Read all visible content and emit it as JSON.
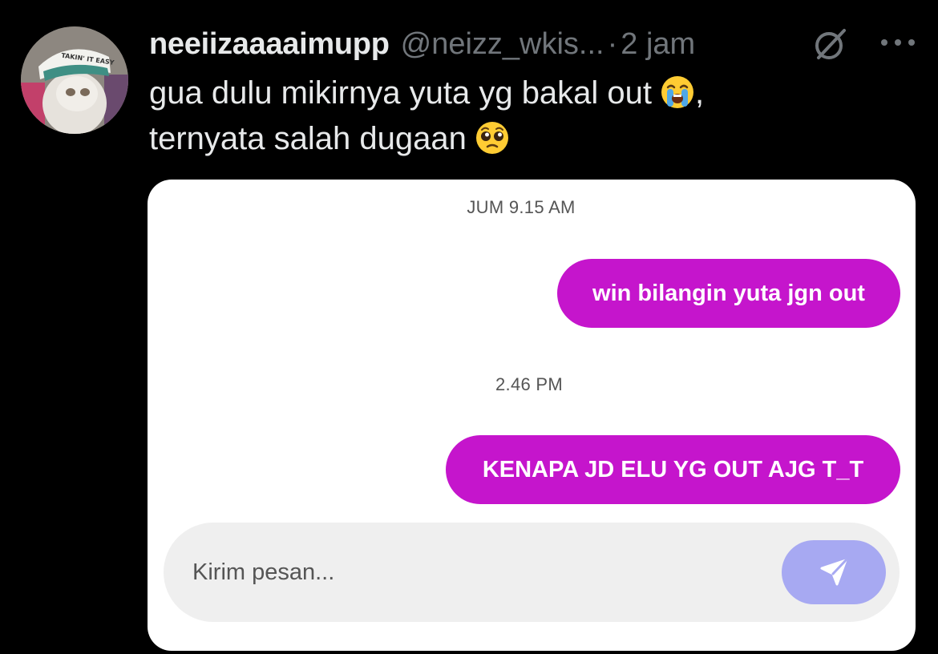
{
  "tweet": {
    "display_name": "neeiizaaaaimupp",
    "handle": "@neizz_wkis...",
    "separator": "·",
    "time": "2 jam",
    "text_line1": "gua dulu mikirnya yuta yg bakal out",
    "text_line1_suffix": ",",
    "text_line2": "ternyata salah dugaan",
    "emoji1": "loudly-crying-face",
    "emoji2": "pleading-face",
    "avatar_text": "TAKIN' IT EASY"
  },
  "chat": {
    "timestamp1": "JUM 9.15 AM",
    "message1": "win bilangin yuta jgn out",
    "timestamp2": "2.46 PM",
    "message2": "KENAPA JD ELU YG OUT AJG T_T",
    "input_placeholder": "Kirim pesan...",
    "bubble_color": "#c515cc",
    "send_button_color": "#a7a9f2"
  },
  "icons": {
    "grok": "grok-icon",
    "more": "more-options-icon",
    "send": "send-icon"
  }
}
